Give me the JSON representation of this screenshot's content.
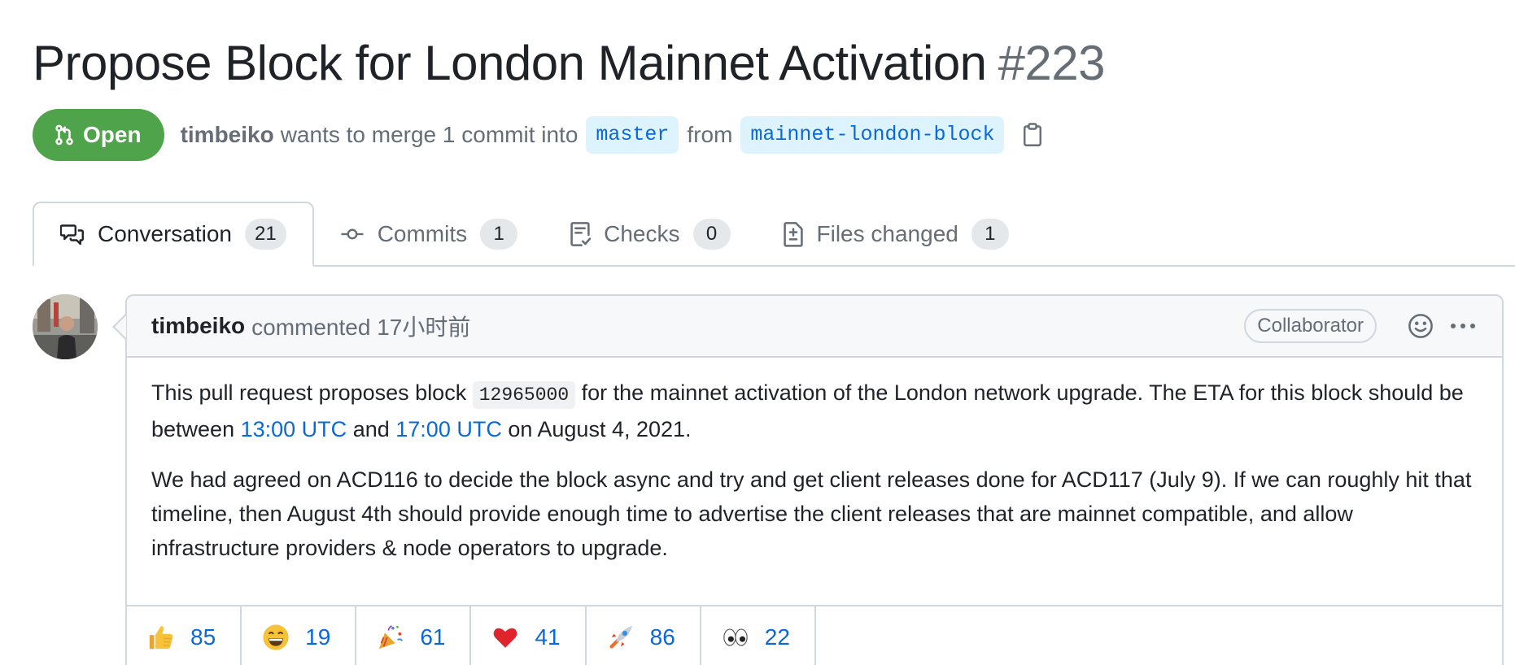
{
  "pr": {
    "title": "Propose Block for London Mainnet Activation",
    "number": "#223",
    "state": "Open",
    "author": "timbeiko",
    "merge_text_1": "wants to merge 1 commit into",
    "base_branch": "master",
    "from_text": "from",
    "head_branch": "mainnet-london-block"
  },
  "tabs": [
    {
      "label": "Conversation",
      "count": "21",
      "icon": "comment-discussion-icon"
    },
    {
      "label": "Commits",
      "count": "1",
      "icon": "git-commit-icon"
    },
    {
      "label": "Checks",
      "count": "0",
      "icon": "checklist-icon"
    },
    {
      "label": "Files changed",
      "count": "1",
      "icon": "file-diff-icon"
    }
  ],
  "comment": {
    "author": "timbeiko",
    "action": "commented 17小时前",
    "role": "Collaborator",
    "p1_a": "This pull request proposes block",
    "p1_code": "12965000",
    "p1_b": "for the mainnet activation of the London network upgrade. The ETA for this block should be between",
    "p1_link1": "13:00 UTC",
    "p1_and": "and",
    "p1_link2": "17:00 UTC",
    "p1_c": "on August 4, 2021.",
    "p2": "We had agreed on ACD116 to decide the block async and try and get client releases done for ACD117 (July 9). If we can roughly hit that timeline, then August 4th should provide enough time to advertise the client releases that are mainnet compatible, and allow infrastructure providers & node operators to upgrade."
  },
  "reactions": [
    {
      "emoji": "thumbs-up",
      "count": "85"
    },
    {
      "emoji": "laugh",
      "count": "19"
    },
    {
      "emoji": "hooray",
      "count": "61"
    },
    {
      "emoji": "heart",
      "count": "41"
    },
    {
      "emoji": "rocket",
      "count": "86"
    },
    {
      "emoji": "eyes",
      "count": "22"
    }
  ],
  "colors": {
    "open_green": "#4fa34b",
    "link_blue": "#0969da",
    "branch_bg": "#ddf4ff",
    "border": "#d0d7de",
    "muted": "#656d76"
  }
}
